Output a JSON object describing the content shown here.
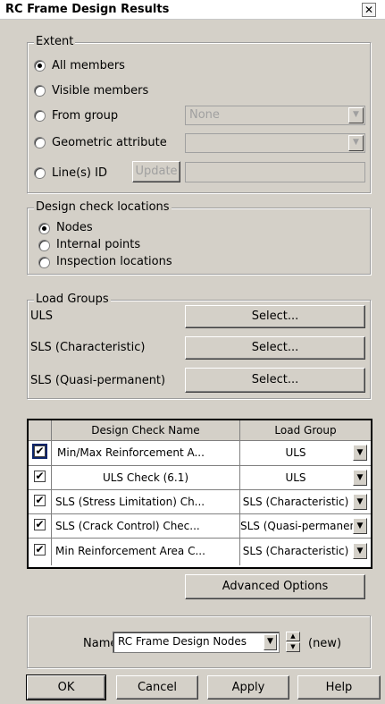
{
  "window": {
    "title": "RC Frame Design Results",
    "close_glyph": "✕"
  },
  "extent": {
    "legend": "Extent",
    "options": [
      "All members",
      "Visible members",
      "From group",
      "Geometric attribute",
      "Line(s) ID"
    ],
    "selected": "All members",
    "from_group_value": "None",
    "update_label": "Update"
  },
  "design_check_locations": {
    "legend": "Design check locations",
    "options": [
      "Nodes",
      "Internal points",
      "Inspection locations"
    ],
    "selected": "Nodes"
  },
  "load_groups": {
    "legend": "Load Groups",
    "rows": [
      {
        "label": "ULS",
        "button": "Select..."
      },
      {
        "label": "SLS (Characteristic)",
        "button": "Select..."
      },
      {
        "label": "SLS (Quasi-permanent)",
        "button": "Select..."
      }
    ]
  },
  "checks_table": {
    "headers": [
      "Design Check Name",
      "Load Group"
    ],
    "rows": [
      {
        "checked": true,
        "name": "Min/Max Reinforcement A...",
        "load_group": "ULS"
      },
      {
        "checked": true,
        "name": "ULS Check (6.1)",
        "load_group": "ULS"
      },
      {
        "checked": true,
        "name": "SLS (Stress Limitation) Ch...",
        "load_group": "SLS (Characteristic)"
      },
      {
        "checked": true,
        "name": "SLS (Crack Control) Chec...",
        "load_group": "SLS (Quasi-permanent)"
      },
      {
        "checked": true,
        "name": "Min Reinforcement Area C...",
        "load_group": "SLS (Characteristic)"
      }
    ],
    "check_glyph": "✔",
    "dropdown_glyph": "▼"
  },
  "advanced_options_label": "Advanced Options",
  "name_row": {
    "label": "Name",
    "value": "RC Frame Design Nodes",
    "status": "(new)"
  },
  "buttons": {
    "ok": "OK",
    "cancel": "Cancel",
    "apply": "Apply",
    "help": "Help"
  }
}
